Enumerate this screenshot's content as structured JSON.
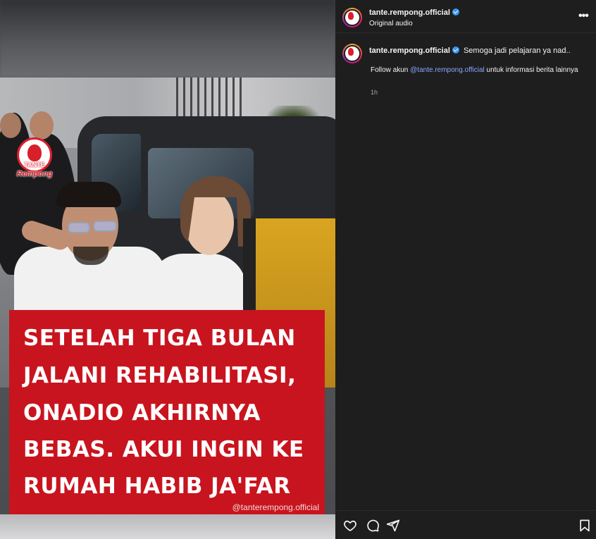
{
  "media": {
    "logo_title": "TANTE",
    "logo_subtitle": "Rempong",
    "caption_lines": [
      "SETELAH TIGA BULAN",
      "JALANI REHABILITASI,",
      "ONADIO AKHIRNYA",
      "BEBAS. AKUI INGIN KE",
      "RUMAH HABIB JA'FAR"
    ],
    "watermark": "@tanterempong.official"
  },
  "header": {
    "username": "tante.rempong.official",
    "audio_label": "Original audio",
    "more_icon": "more-icon"
  },
  "comment": {
    "username": "tante.rempong.official",
    "text_preview": "Semoga jadi pelajaran ya nad..",
    "follow_prefix": "Follow akun ",
    "follow_mention": "@tante.rempong.official",
    "follow_suffix": " untuk informasi berita lainnya",
    "time": "1h"
  },
  "actions": {
    "like_icon": "heart-icon",
    "comment_icon": "comment-icon",
    "share_icon": "share-icon",
    "save_icon": "bookmark-icon"
  },
  "colors": {
    "caption_red": "#c8141e",
    "verified_blue": "#3897f0",
    "mention_blue": "#8aa8ff",
    "panel_bg": "#1e1e1e"
  }
}
